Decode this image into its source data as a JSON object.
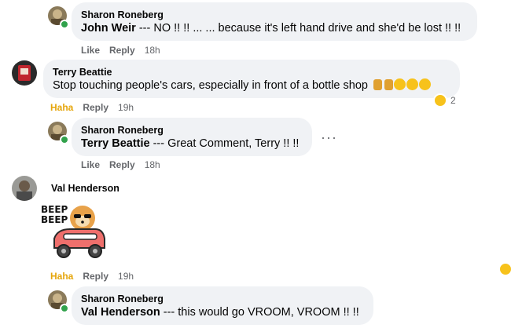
{
  "comments": [
    {
      "author": "Sharon Roneberg",
      "mention": "John Weir",
      "body": " --- NO !! !! ... ... because it's left hand drive and she'd be lost !! !!",
      "like": "Like",
      "reply": "Reply",
      "time": "18h"
    },
    {
      "author": "Terry Beattie",
      "body": "Stop touching people's cars, especially in front of a bottle shop",
      "reaction_label": "Haha",
      "reply": "Reply",
      "time": "19h",
      "reaction_count": "2",
      "icons": [
        "beer-mug-icon",
        "beer-mug-icon",
        "laughing-face-icon",
        "laughing-face-icon",
        "laughing-face-icon"
      ]
    },
    {
      "author": "Sharon Roneberg",
      "mention": "Terry Beattie",
      "body": " --- Great Comment, Terry !! !!",
      "like": "Like",
      "reply": "Reply",
      "time": "18h",
      "more": "···"
    },
    {
      "author": "Val Henderson",
      "sticker_text": [
        "BEEP",
        "BEEP"
      ],
      "reaction_label": "Haha",
      "reply": "Reply",
      "time": "19h"
    },
    {
      "author": "Sharon Roneberg",
      "mention": "Val Henderson",
      "body": " --- this would go VROOM, VROOM !! !!"
    }
  ],
  "colors": {
    "bubble": "#f0f2f5",
    "action_text": "#65676b",
    "haha": "#e5a50a",
    "online": "#31a24c"
  }
}
